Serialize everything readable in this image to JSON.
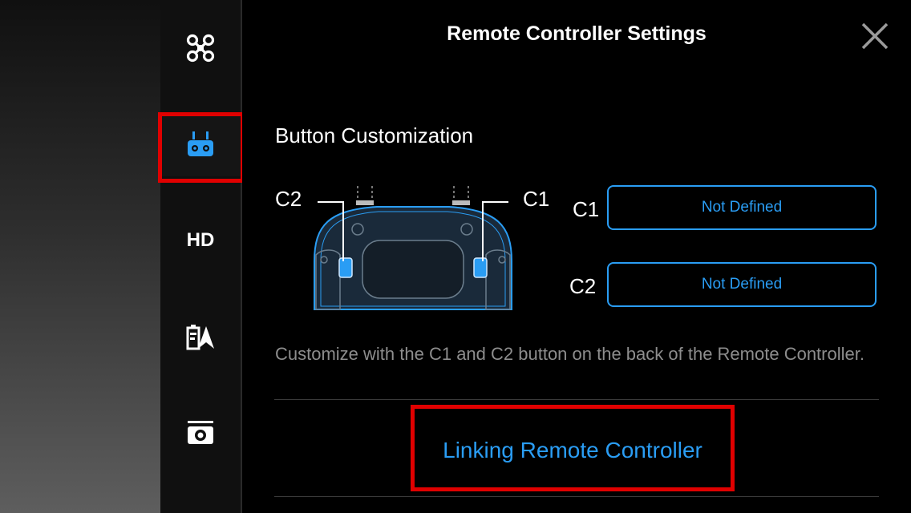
{
  "header": {
    "title": "Remote Controller Settings"
  },
  "sidebar": {
    "items": [
      {
        "id": "aircraft",
        "icon": "drone-icon"
      },
      {
        "id": "remote-controller",
        "icon": "remote-controller-icon",
        "active": true
      },
      {
        "id": "hd",
        "icon": "hd-icon",
        "label": "HD"
      },
      {
        "id": "battery",
        "icon": "battery-icon"
      },
      {
        "id": "gimbal",
        "icon": "camera-gimbal-icon"
      }
    ]
  },
  "main": {
    "section_title": "Button Customization",
    "diagram": {
      "c1_callout": "C1",
      "c2_callout": "C2"
    },
    "c1": {
      "label": "C1",
      "value": "Not Defined"
    },
    "c2": {
      "label": "C2",
      "value": "Not Defined"
    },
    "description": "Customize with the C1 and C2 button on the back of the Remote Controller.",
    "link_label": "Linking Remote Controller"
  },
  "colors": {
    "accent": "#2a9df4",
    "highlight": "#e00000",
    "background": "#000000",
    "muted_text": "#8d8d8d"
  }
}
